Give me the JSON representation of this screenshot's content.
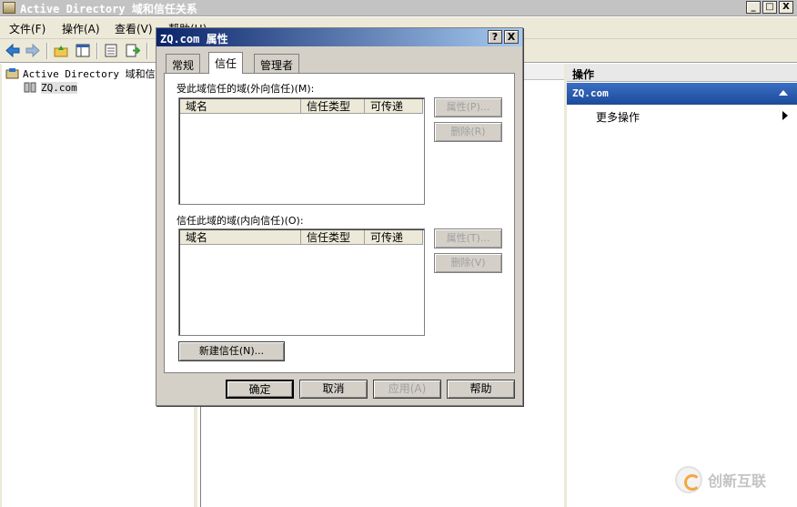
{
  "window": {
    "title": "Active Directory 域和信任关系",
    "min": "_",
    "max": "□",
    "close": "X"
  },
  "menu": [
    {
      "label": "文件(F)"
    },
    {
      "label": "操作(A)"
    },
    {
      "label": "查看(V)"
    },
    {
      "label": "帮助(H)"
    }
  ],
  "tree": {
    "root": "Active Directory 域和信任关系",
    "child": "ZQ.com"
  },
  "actions": {
    "header": "操作",
    "group": "ZQ.com",
    "more": "更多操作"
  },
  "dialog": {
    "title": "ZQ.com 属性",
    "help_btn": "?",
    "close_btn": "X",
    "tabs": [
      {
        "label": "常规"
      },
      {
        "label": "信任"
      },
      {
        "label": "管理者"
      }
    ],
    "outgoing": {
      "label": "受此域信任的域(外向信任)(M):",
      "columns": [
        "域名",
        "信任类型",
        "可传递"
      ],
      "properties_btn": "属性(P)...",
      "remove_btn": "删除(R)"
    },
    "incoming": {
      "label": "信任此域的域(内向信任)(O):",
      "columns": [
        "域名",
        "信任类型",
        "可传递"
      ],
      "properties_btn": "属性(T)...",
      "remove_btn": "删除(V)"
    },
    "new_trust_btn": "新建信任(N)...",
    "buttons": {
      "ok": "确定",
      "cancel": "取消",
      "apply": "应用(A)",
      "help": "帮助"
    }
  },
  "watermark": {
    "text": "创新互联"
  }
}
